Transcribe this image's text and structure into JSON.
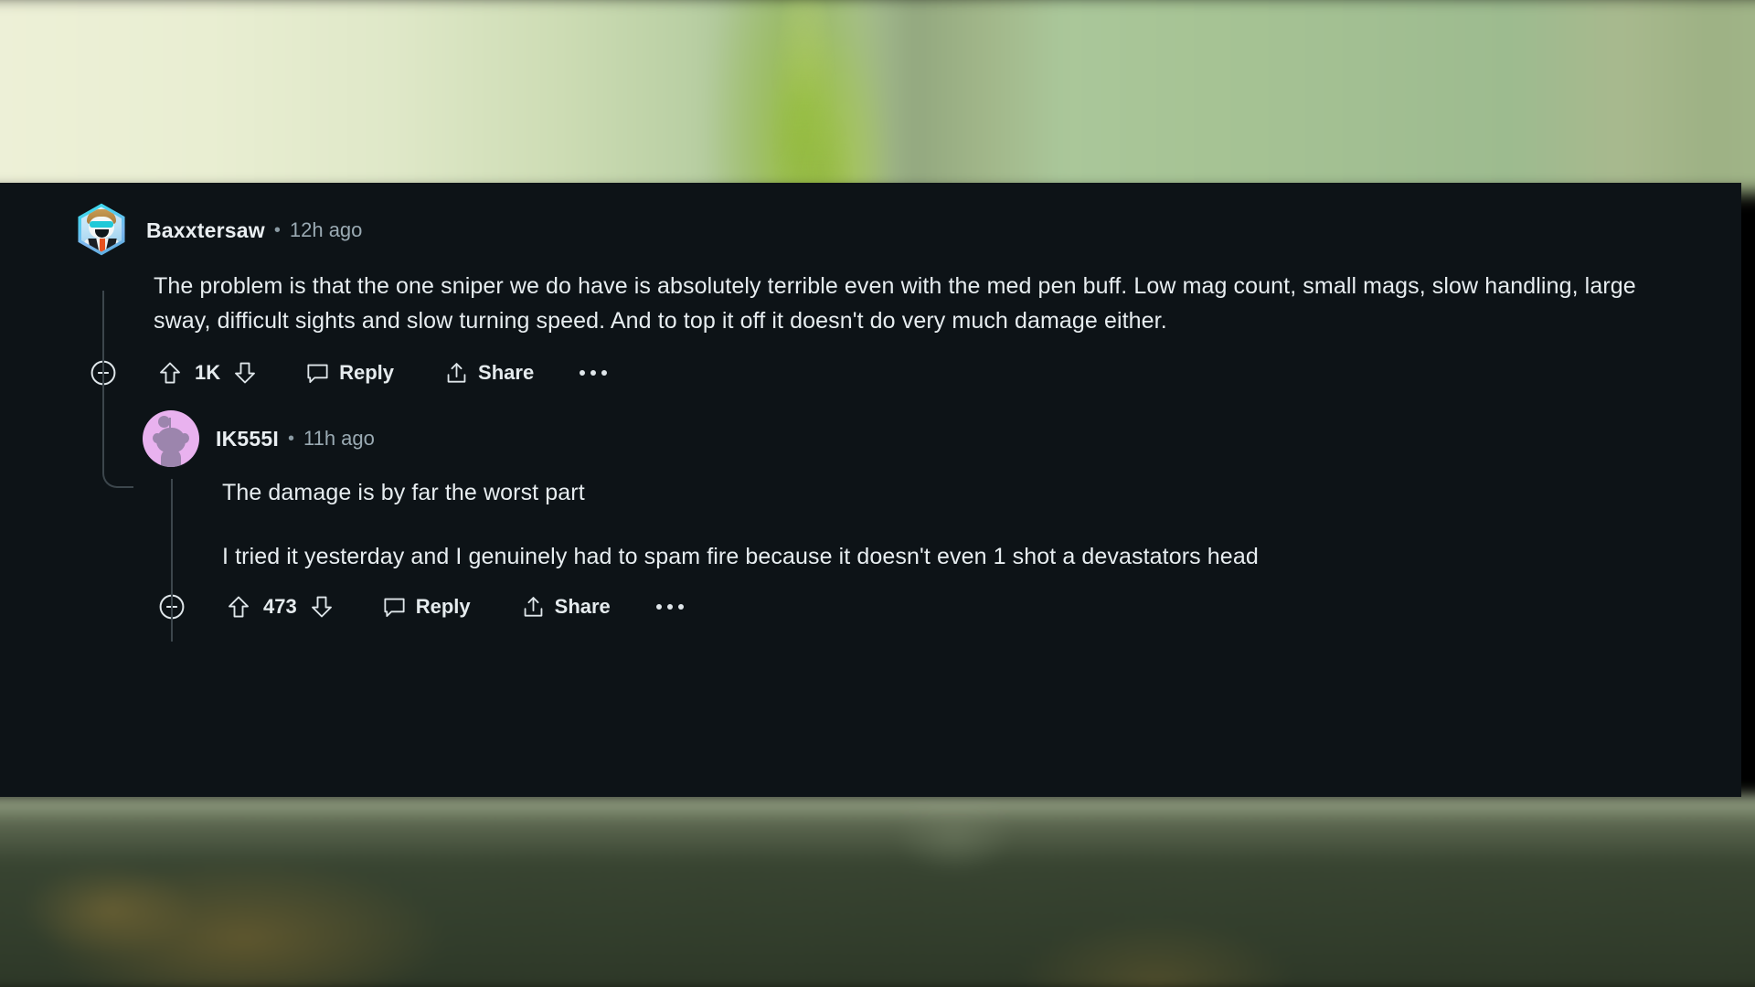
{
  "overlay": {
    "background_top_desc": "blurred-green-plant",
    "background_bottom_desc": "blurred-grass-field",
    "panel_color": "#0d1317",
    "text_color": "#e7edf0",
    "meta_color": "#9aaab3",
    "thread_line_color": "#3c464c"
  },
  "comments": [
    {
      "username": "Baxxtersaw",
      "separator": "•",
      "timestamp": "12h ago",
      "avatar_type": "hexagon-custom-avatar",
      "paragraphs": [
        "The problem is that the one sniper we do have is absolutely terrible even with the med pen buff. Low mag count, small mags, slow handling, large sway, difficult sights and slow turning speed. And to top it off it doesn't do very much damage either."
      ],
      "actions": {
        "collapse_label": "Collapse",
        "upvote_label": "Upvote",
        "vote_count": "1K",
        "downvote_label": "Downvote",
        "reply_label": "Reply",
        "share_label": "Share",
        "more_label": "More options"
      }
    },
    {
      "username": "IK555I",
      "separator": "•",
      "timestamp": "11h ago",
      "avatar_type": "circle-default-snoo",
      "avatar_color": "#e9b2ef",
      "paragraphs": [
        "The damage is by far the worst part",
        "I tried it yesterday and I genuinely had to spam fire because it doesn't even 1 shot a devastators head"
      ],
      "actions": {
        "collapse_label": "Collapse",
        "upvote_label": "Upvote",
        "vote_count": "473",
        "downvote_label": "Downvote",
        "reply_label": "Reply",
        "share_label": "Share",
        "more_label": "More options"
      }
    }
  ]
}
